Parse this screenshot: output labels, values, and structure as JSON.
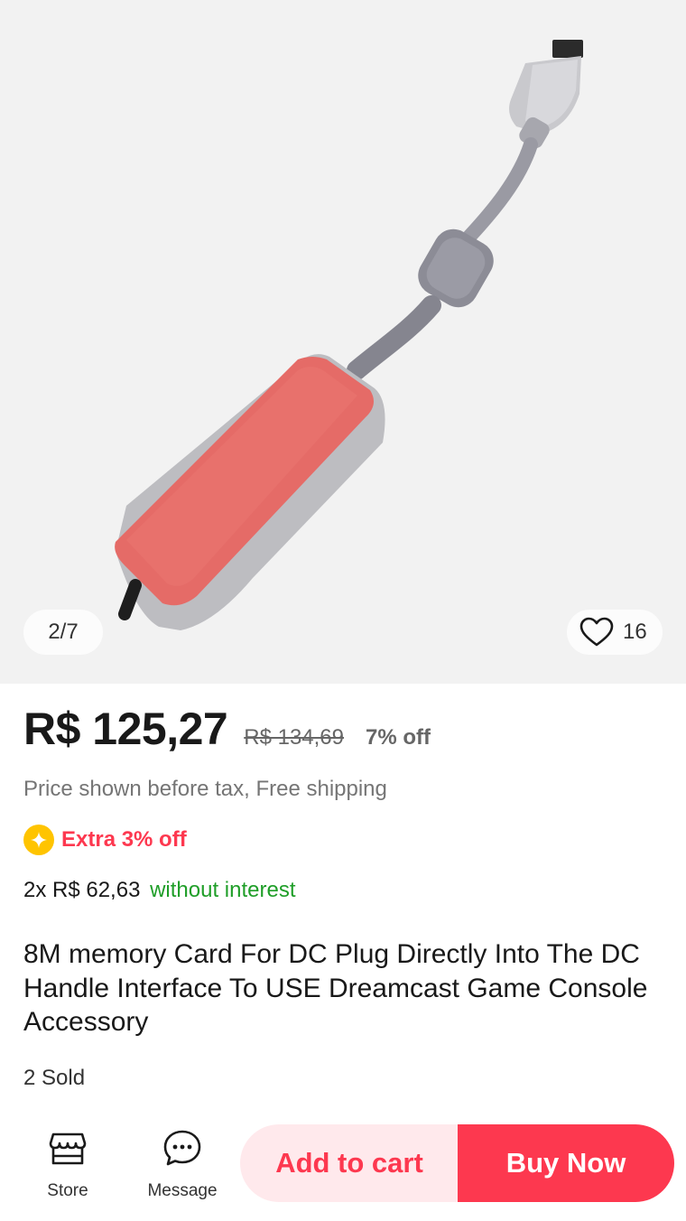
{
  "gallery": {
    "counter": "2/7",
    "favorites_count": "16",
    "image_alt": "memory card with cable"
  },
  "price": {
    "current": "R$ 125,27",
    "original": "R$ 134,69",
    "discount": "7% off",
    "tax_note": "Price shown before tax, Free shipping"
  },
  "promo": {
    "extra": "Extra 3% off"
  },
  "installment": {
    "amount": "2x R$ 62,63",
    "interest": "without interest"
  },
  "product": {
    "title": "8M memory Card For DC Plug Directly Into The DC Handle Interface To USE Dreamcast Game Console Accessory",
    "sold": "2 Sold"
  },
  "bottom_bar": {
    "store_label": "Store",
    "message_label": "Message",
    "add_to_cart": "Add to cart",
    "buy_now": "Buy Now"
  },
  "colors": {
    "accent": "#fd384f",
    "accent_light": "#ffe9ec",
    "interest_green": "#1f9e28",
    "coin_yellow": "#ffc400"
  }
}
